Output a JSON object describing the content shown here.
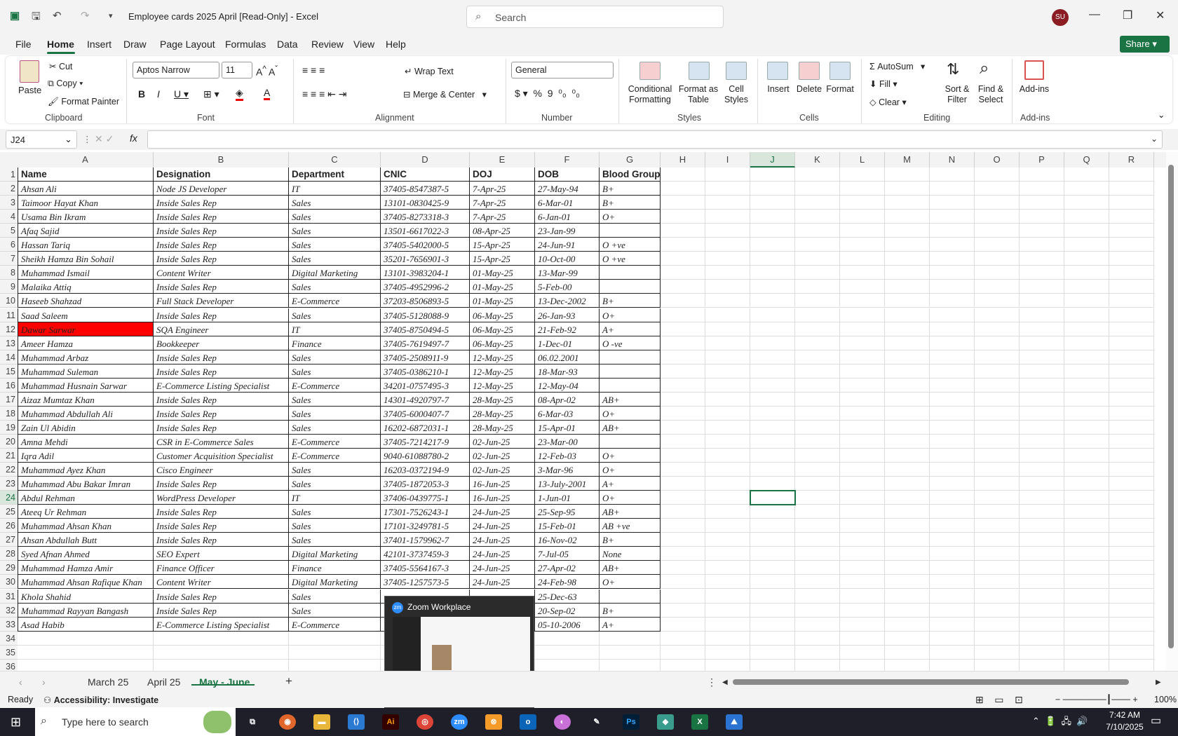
{
  "titlebar": {
    "title": "Employee cards 2025 April  [Read-Only]  -  Excel",
    "search_placeholder": "Search",
    "avatar": "SU"
  },
  "menu": [
    "File",
    "Home",
    "Insert",
    "Draw",
    "Page Layout",
    "Formulas",
    "Data",
    "Review",
    "View",
    "Help"
  ],
  "share": "Share",
  "ribbon": {
    "clipboard": {
      "paste": "Paste",
      "cut": "Cut",
      "copy": "Copy",
      "format_painter": "Format Painter",
      "label": "Clipboard"
    },
    "font": {
      "name": "Aptos Narrow",
      "size": "11",
      "label": "Font"
    },
    "alignment": {
      "wrap": "Wrap Text",
      "merge": "Merge & Center",
      "label": "Alignment"
    },
    "number": {
      "format": "General",
      "label": "Number"
    },
    "styles": {
      "conditional": "Conditional Formatting",
      "format_table": "Format as Table",
      "cell_styles": "Cell Styles",
      "label": "Styles"
    },
    "cells": {
      "insert": "Insert",
      "delete": "Delete",
      "format": "Format",
      "label": "Cells"
    },
    "editing": {
      "autosum": "AutoSum",
      "fill": "Fill",
      "clear": "Clear",
      "sort": "Sort & Filter",
      "find": "Find & Select",
      "label": "Editing"
    },
    "addins": {
      "addins": "Add-ins",
      "label": "Add-ins"
    }
  },
  "formula": {
    "namebox": "J24",
    "fx": "fx"
  },
  "columns": [
    "A",
    "B",
    "C",
    "D",
    "E",
    "F",
    "G",
    "H",
    "I",
    "J",
    "K",
    "L",
    "M",
    "N",
    "O",
    "P",
    "Q",
    "R"
  ],
  "headers": [
    "Name",
    "Designation",
    "Department",
    "CNIC",
    "DOJ",
    "DOB",
    "Blood Group"
  ],
  "rows": [
    [
      "Ahsan Ali",
      "Node JS Developer",
      "IT",
      "37405-8547387-5",
      "7-Apr-25",
      "27-May-94",
      "B+"
    ],
    [
      "Taimoor Hayat Khan",
      "Inside Sales Rep",
      "Sales",
      "13101-0830425-9",
      "7-Apr-25",
      "6-Mar-01",
      "B+"
    ],
    [
      "Usama Bin Ikram",
      "Inside Sales Rep",
      "Sales",
      "37405-8273318-3",
      "7-Apr-25",
      "6-Jan-01",
      "O+"
    ],
    [
      "Afaq Sajid",
      "Inside Sales Rep",
      "Sales",
      "13501-6617022-3",
      "08-Apr-25",
      "23-Jan-99",
      ""
    ],
    [
      "Hassan Tariq",
      "Inside Sales Rep",
      "Sales",
      "37405-5402000-5",
      "15-Apr-25",
      "24-Jun-91",
      "O +ve"
    ],
    [
      "Sheikh Hamza Bin Sohail",
      "Inside Sales Rep",
      "Sales",
      "35201-7656901-3",
      "15-Apr-25",
      "10-Oct-00",
      "O +ve"
    ],
    [
      "Muhammad Ismail",
      "Content Writer",
      "Digital Marketing",
      "13101-3983204-1",
      "01-May-25",
      "13-Mar-99",
      ""
    ],
    [
      "Malaika Attiq",
      "Inside Sales Rep",
      "Sales",
      "37405-4952996-2",
      "01-May-25",
      "5-Feb-00",
      ""
    ],
    [
      "Haseeb Shahzad",
      "Full Stack Developer",
      "E-Commerce",
      "37203-8506893-5",
      "01-May-25",
      "13-Dec-2002",
      "B+"
    ],
    [
      "Saad Saleem",
      "Inside Sales Rep",
      "Sales",
      "37405-5128088-9",
      "06-May-25",
      "26-Jan-93",
      "O+"
    ],
    [
      "Dawar Sarwar",
      "SQA Engineer",
      "IT",
      "37405-8750494-5",
      "06-May-25",
      "21-Feb-92",
      "A+"
    ],
    [
      "Ameer Hamza",
      "Bookkeeper",
      "Finance",
      "37405-7619497-7",
      "06-May-25",
      "1-Dec-01",
      "O -ve"
    ],
    [
      "Muhammad Arbaz",
      "Inside Sales Rep",
      "Sales",
      "37405-2508911-9",
      "12-May-25",
      "06.02.2001",
      ""
    ],
    [
      "Muhammad Suleman",
      "Inside Sales Rep",
      "Sales",
      "37405-0386210-1",
      "12-May-25",
      "18-Mar-93",
      ""
    ],
    [
      "Muhammad Husnain Sarwar",
      "E-Commerce Listing Specialist",
      "E-Commerce",
      "34201-0757495-3",
      "12-May-25",
      "12-May-04",
      ""
    ],
    [
      "Aizaz Mumtaz Khan",
      "Inside Sales Rep",
      "Sales",
      "14301-4920797-7",
      "28-May-25",
      "08-Apr-02",
      "AB+"
    ],
    [
      "Muhammad Abdullah Ali",
      "Inside Sales Rep",
      "Sales",
      "37405-6000407-7",
      "28-May-25",
      "6-Mar-03",
      "O+"
    ],
    [
      "Zain Ul Abidin",
      "Inside Sales Rep",
      "Sales",
      "16202-6872031-1",
      "28-May-25",
      "15-Apr-01",
      "AB+"
    ],
    [
      "Amna Mehdi",
      "CSR in E-Commerce Sales",
      "E-Commerce",
      "37405-7214217-9",
      "02-Jun-25",
      "23-Mar-00",
      ""
    ],
    [
      "Iqra Adil",
      "Customer Acquisition Specialist",
      "E-Commerce",
      "9040-61088780-2",
      "02-Jun-25",
      "12-Feb-03",
      "O+"
    ],
    [
      "Muhammad Ayez Khan",
      "Cisco Engineer",
      "Sales",
      "16203-0372194-9",
      "02-Jun-25",
      "3-Mar-96",
      "O+"
    ],
    [
      "Muhammad Abu Bakar Imran",
      "Inside Sales Rep",
      "Sales",
      "37405-1872053-3",
      "16-Jun-25",
      "13-July-2001",
      "A+"
    ],
    [
      "Abdul Rehman",
      "WordPress Developer",
      "IT",
      "37406-0439775-1",
      "16-Jun-25",
      "1-Jun-01",
      "O+"
    ],
    [
      "Ateeq Ur Rehman",
      "Inside Sales Rep",
      "Sales",
      "17301-7526243-1",
      "24-Jun-25",
      "25-Sep-95",
      "AB+"
    ],
    [
      "Muhammad Ahsan Khan",
      "Inside Sales Rep",
      "Sales",
      "17101-3249781-5",
      "24-Jun-25",
      "15-Feb-01",
      "AB +ve"
    ],
    [
      "Ahsan Abdullah Butt",
      "Inside Sales Rep",
      "Sales",
      "37401-1579962-7",
      "24-Jun-25",
      "16-Nov-02",
      "B+"
    ],
    [
      "Syed Afnan Ahmed",
      "SEO Expert",
      "Digital Marketing",
      "42101-3737459-3",
      "24-Jun-25",
      "7-Jul-05",
      "None"
    ],
    [
      "Muhammad Hamza Amir",
      "Finance Officer",
      "Finance",
      "37405-5564167-3",
      "24-Jun-25",
      "27-Apr-02",
      "AB+"
    ],
    [
      "Muhammad Ahsan Rafique Khan",
      "Content Writer",
      "Digital Marketing",
      "37405-1257573-5",
      "24-Jun-25",
      "24-Feb-98",
      "O+"
    ],
    [
      "Khola Shahid",
      "Inside Sales Rep",
      "Sales",
      "",
      "",
      "25-Dec-63",
      ""
    ],
    [
      "Muhammad Rayyan Bangash",
      "Inside Sales Rep",
      "Sales",
      "",
      "",
      "20-Sep-02",
      "B+"
    ],
    [
      "Asad Habib",
      "E-Commerce Listing Specialist",
      "E-Commerce",
      "",
      "",
      "05-10-2006",
      "A+"
    ]
  ],
  "sheet_tabs": [
    "March 25",
    "April 25",
    "May - June"
  ],
  "status": {
    "ready": "Ready",
    "accessibility": "Accessibility: Investigate",
    "zoom": "100%"
  },
  "popup": {
    "title": "Zoom Workplace"
  },
  "taskbar": {
    "search": "Type here to search",
    "time": "7:42 AM",
    "date": "7/10/2025"
  },
  "colors": {
    "excel_green": "#1a7343",
    "highlight_red": "#ff0000"
  }
}
